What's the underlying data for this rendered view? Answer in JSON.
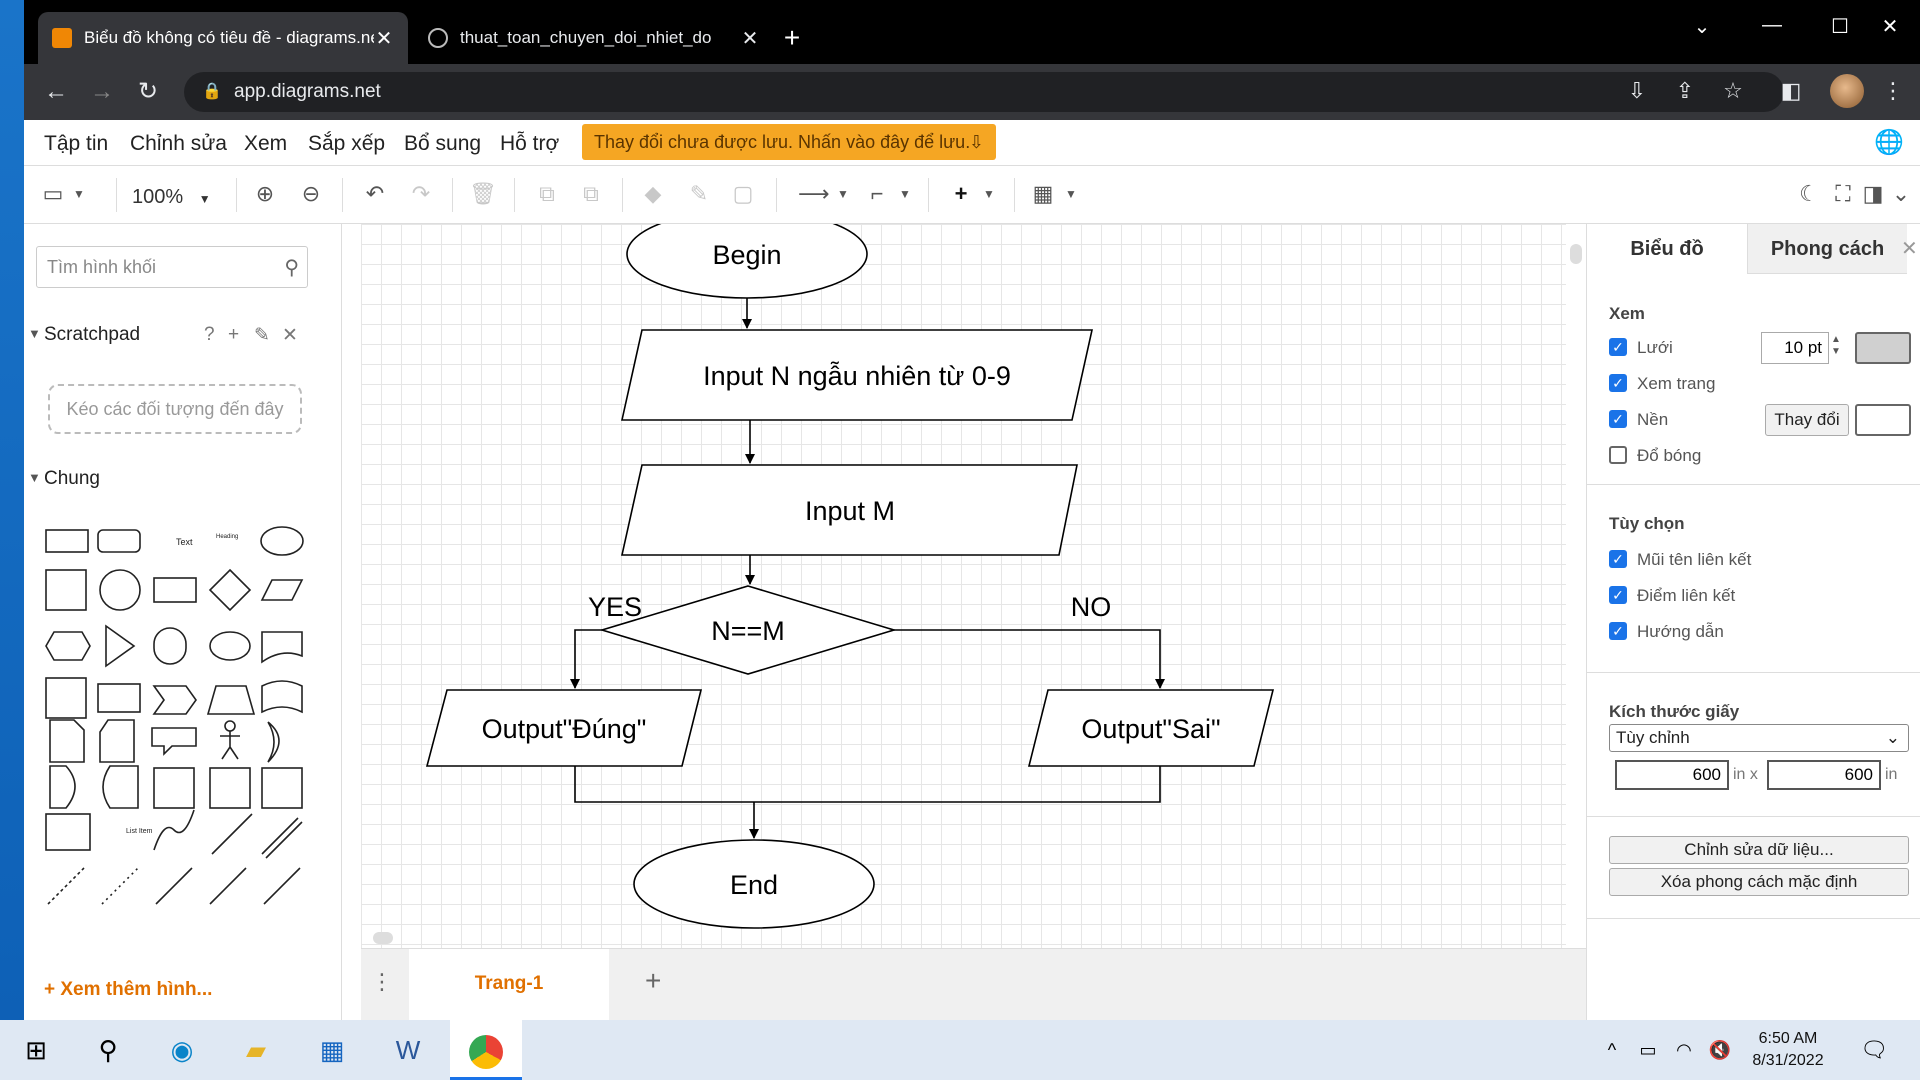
{
  "browser": {
    "tabs": [
      {
        "title": "Biểu đồ không có tiêu đề - diagrams.net",
        "active": true
      },
      {
        "title": "thuat_toan_chuyen_doi_nhiet_do",
        "active": false
      }
    ],
    "url": "app.diagrams.net"
  },
  "menu": {
    "items": [
      "Tập tin",
      "Chỉnh sửa",
      "Xem",
      "Sắp xếp",
      "Bổ sung",
      "Hỗ trợ"
    ],
    "unsaved_notice": "Thay đổi chưa được lưu. Nhấn vào đây để lưu."
  },
  "toolbar": {
    "zoom": "100%"
  },
  "sidebar": {
    "search_placeholder": "Tìm hình khối",
    "scratchpad_title": "Scratchpad",
    "scratchpad_drop": "Kéo các đối tượng đến đây",
    "general_title": "Chung",
    "shape_text_label": "Text",
    "shape_heading_label": "Heading",
    "shape_listitem_label": "List Item",
    "more_shapes": "Xem thêm hình..."
  },
  "diagram": {
    "begin": "Begin",
    "input_n": "Input N ngẫu nhiên từ 0-9",
    "input_m": "Input M",
    "decision": "N==M",
    "yes_label": "YES",
    "no_label": "NO",
    "output_true": "Output\"Đúng\"",
    "output_false": "Output\"Sai\"",
    "end": "End"
  },
  "pages": {
    "current": "Trang-1"
  },
  "format_panel": {
    "tab_diagram": "Biểu đồ",
    "tab_style": "Phong cách",
    "view_title": "Xem",
    "grid_label": "Lưới",
    "grid_checked": true,
    "grid_size": "10 pt",
    "page_view_label": "Xem trang",
    "page_view_checked": true,
    "background_label": "Nền",
    "background_checked": true,
    "change_button": "Thay đổi",
    "shadow_label": "Đổ bóng",
    "shadow_checked": false,
    "options_title": "Tùy chọn",
    "connection_arrows_label": "Mũi tên liên kết",
    "connection_points_label": "Điểm liên kết",
    "guides_label": "Hướng dẫn",
    "paper_size_title": "Kích thước giấy",
    "paper_size_value": "Tùy chỉnh",
    "width_value": "600",
    "height_value": "600",
    "unit_in_x": "in x",
    "unit_in": "in",
    "edit_data_button": "Chỉnh sửa dữ liệu...",
    "clear_style_button": "Xóa phong cách mặc định",
    "grid_color": "#d0d0d0",
    "background_color": "#ffffff"
  },
  "taskbar": {
    "time": "6:50 AM",
    "date": "8/31/2022"
  },
  "colors": {
    "accent": "#e07000",
    "unsaved_bg": "#f5a623",
    "checkbox": "#1a73e8"
  }
}
